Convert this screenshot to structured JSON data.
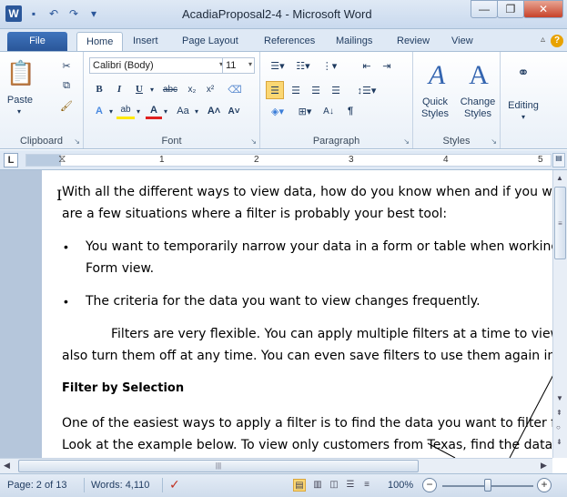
{
  "window": {
    "title": "AcadiaProposal2-4 - Microsoft Word"
  },
  "tabs": [
    "File",
    "Home",
    "Insert",
    "Page Layout",
    "References",
    "Mailings",
    "Review",
    "View"
  ],
  "ribbon": {
    "clipboard": {
      "label": "Clipboard",
      "paste": "Paste"
    },
    "font": {
      "label": "Font",
      "name": "Calibri (Body)",
      "size": "11"
    },
    "paragraph": {
      "label": "Paragraph"
    },
    "styles": {
      "label": "Styles",
      "quick": "Quick Styles",
      "change": "Change Styles"
    },
    "editing": {
      "label": "Editing"
    }
  },
  "ruler": {
    "tab_selector": "L",
    "numbers": [
      "1",
      "2",
      "3",
      "4",
      "5"
    ]
  },
  "document": {
    "p1_l1": "With all the different ways to view data, how do you know when and if you want to",
    "p1_l2": "are a few situations where a filter is probably your best tool:",
    "b1_l1": "You want to temporarily narrow your data in a form or table when working in F",
    "b1_l2": "Form view.",
    "b2": "The criteria for the data you want to view changes frequently.",
    "p2_l1": "Filters are very flexible. You can apply multiple filters at a time to view spec",
    "p2_l2": "also turn them off at any time. You can even save filters to use them again in the fu",
    "heading": "Filter  by Selection",
    "p3_l1": "One of the easiest ways to apply a filter is to find the data you want to filter for, an",
    "p3_l2": "Look at the example below. To view only customers from Texas, find the data you v"
  },
  "status": {
    "page": "Page: 2 of 13",
    "words": "Words: 4,110",
    "zoom": "100%"
  },
  "zoom_level": 100
}
